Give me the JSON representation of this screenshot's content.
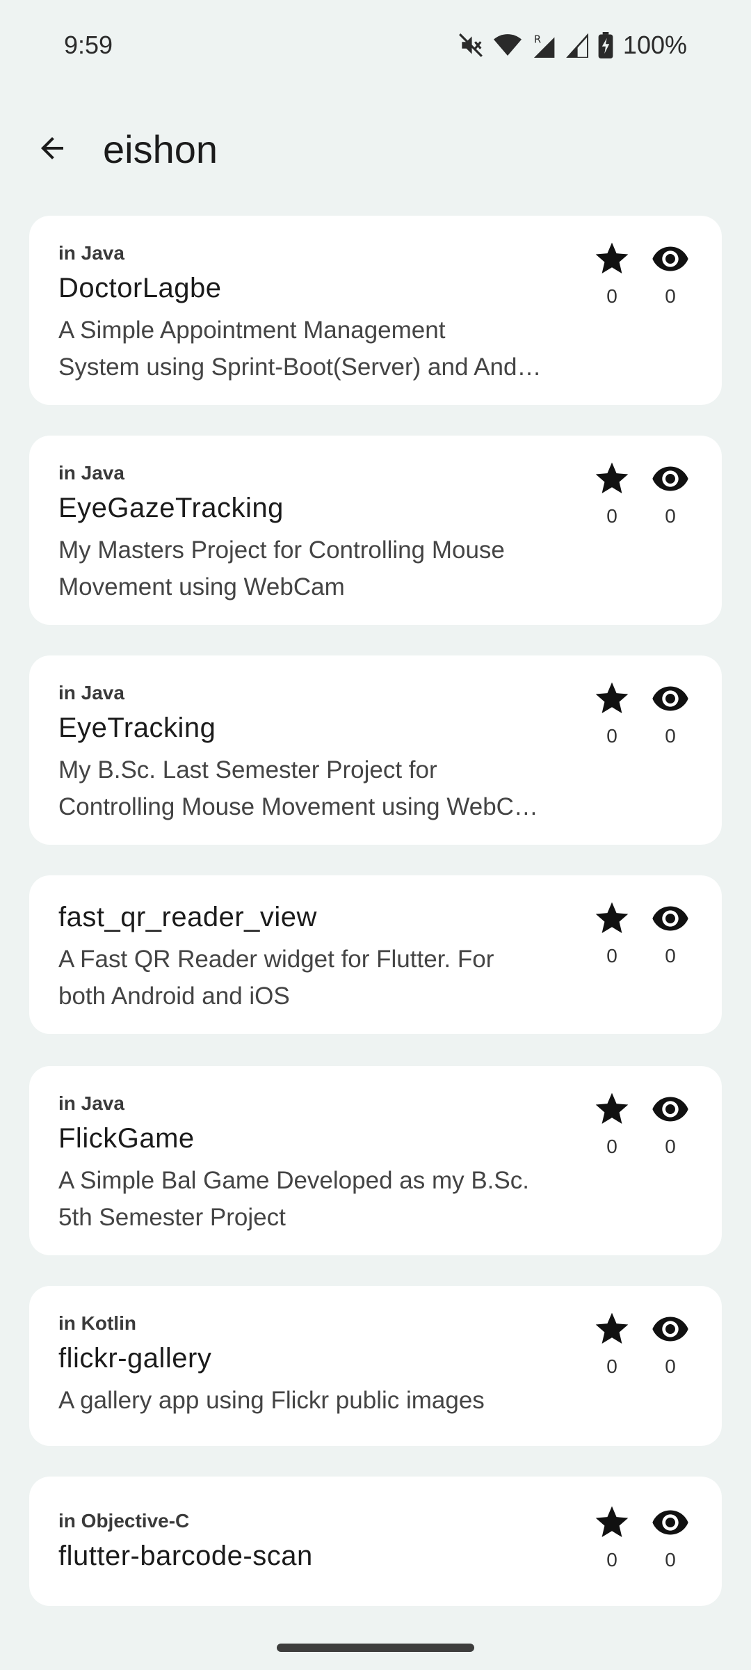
{
  "status_bar": {
    "time": "9:59",
    "battery": "100%",
    "icons": [
      "mute-icon",
      "wifi-icon",
      "signal-r-icon",
      "signal-icon",
      "battery-icon"
    ]
  },
  "app_bar": {
    "title": "eishon",
    "back_icon": "arrow-back-icon"
  },
  "repos": [
    {
      "language": "in Java",
      "name": "DoctorLagbe",
      "description_lines": [
        "A Simple Appointment Management",
        "System using Sprint-Boot(Server) and And…"
      ],
      "stars": "0",
      "watchers": "0"
    },
    {
      "language": "in Java",
      "name": "EyeGazeTracking",
      "description_lines": [
        "My Masters Project for Controlling Mouse",
        "Movement using WebCam"
      ],
      "stars": "0",
      "watchers": "0"
    },
    {
      "language": "in Java",
      "name": "EyeTracking",
      "description_lines": [
        "My B.Sc. Last Semester Project for",
        "Controlling Mouse Movement using WebC…"
      ],
      "stars": "0",
      "watchers": "0"
    },
    {
      "language": "",
      "name": "fast_qr_reader_view",
      "description_lines": [
        "A Fast QR Reader widget for Flutter. For",
        "both Android and iOS"
      ],
      "stars": "0",
      "watchers": "0"
    },
    {
      "language": "in Java",
      "name": "FlickGame",
      "description_lines": [
        "A Simple Bal Game Developed as my B.Sc.",
        "5th Semester Project"
      ],
      "stars": "0",
      "watchers": "0"
    },
    {
      "language": "in Kotlin",
      "name": "flickr-gallery",
      "description_lines": [
        "A gallery app using Flickr public images"
      ],
      "stars": "0",
      "watchers": "0"
    },
    {
      "language": "in Objective-C",
      "name": "flutter-barcode-scan",
      "description_lines": [],
      "stars": "0",
      "watchers": "0"
    }
  ],
  "colors": {
    "background": "#eef3f2",
    "card": "#ffffff",
    "text": "#1b1b1b"
  }
}
